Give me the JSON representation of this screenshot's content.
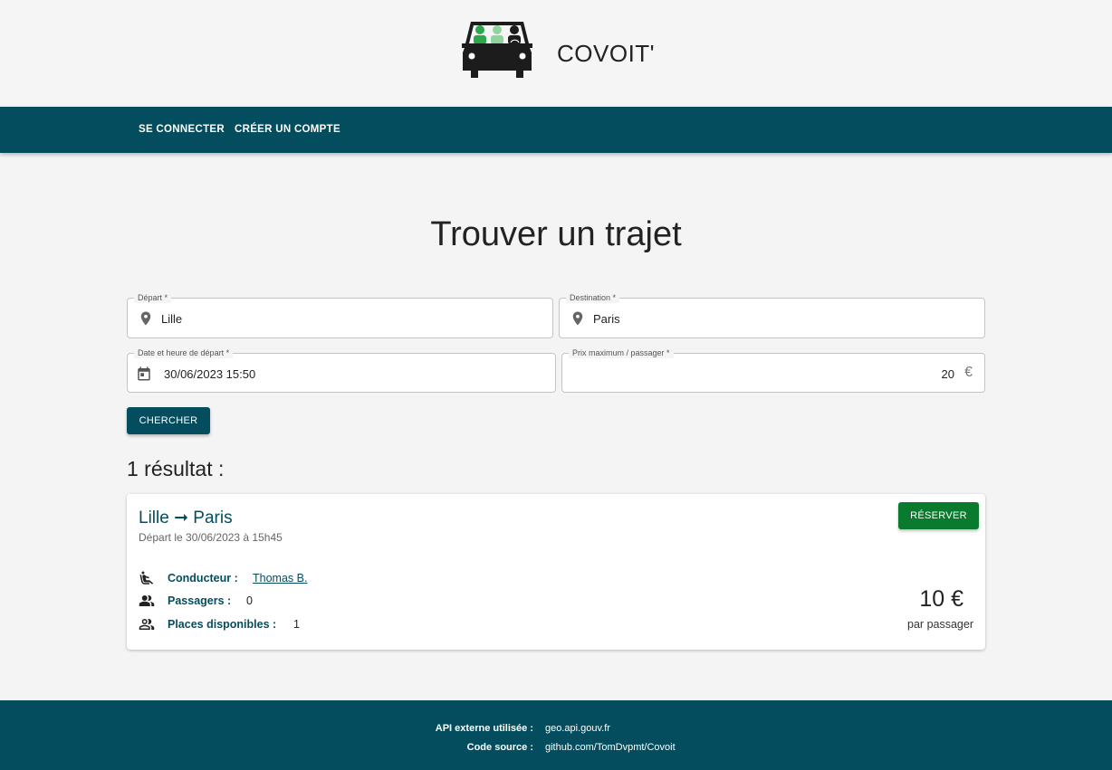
{
  "header": {
    "brand": "COVOIT'"
  },
  "nav": {
    "login": "SE CONNECTER",
    "signup": "CRÉER UN COMPTE"
  },
  "search": {
    "title": "Trouver un trajet",
    "departure": {
      "label": "Départ *",
      "value": "Lille",
      "icon": "location-pin-icon"
    },
    "destination": {
      "label": "Destination *",
      "value": "Paris",
      "icon": "location-pin-icon"
    },
    "datetime": {
      "label": "Date et heure de départ *",
      "value": "30/06/2023 15:50",
      "icon": "calendar-icon"
    },
    "max_price": {
      "label": "Prix maximum / passager *",
      "value": "20",
      "unit": "€"
    },
    "submit_label": "CHERCHER"
  },
  "results": {
    "title": "1 résultat :",
    "items": [
      {
        "route": "Lille ➞ Paris",
        "departure_text": "Départ le 30/06/2023 à 15h45",
        "book_label": "RÉSERVER",
        "driver_label": "Conducteur :",
        "driver_value": "Thomas B.",
        "passengers_label": "Passagers :",
        "passengers_value": "0",
        "seats_label": "Places disponibles :",
        "seats_value": "1",
        "price": "10 €",
        "price_unit": "par passager"
      }
    ]
  },
  "footer": {
    "api_label": "API externe utilisée :",
    "api_value": "geo.api.gouv.fr",
    "source_label": "Code source :",
    "source_value": "github.com/TomDvpmt/Covoit"
  },
  "colors": {
    "primary": "#044d5e",
    "accent_green": "#0a7b2e",
    "background": "#f4f4f5"
  }
}
